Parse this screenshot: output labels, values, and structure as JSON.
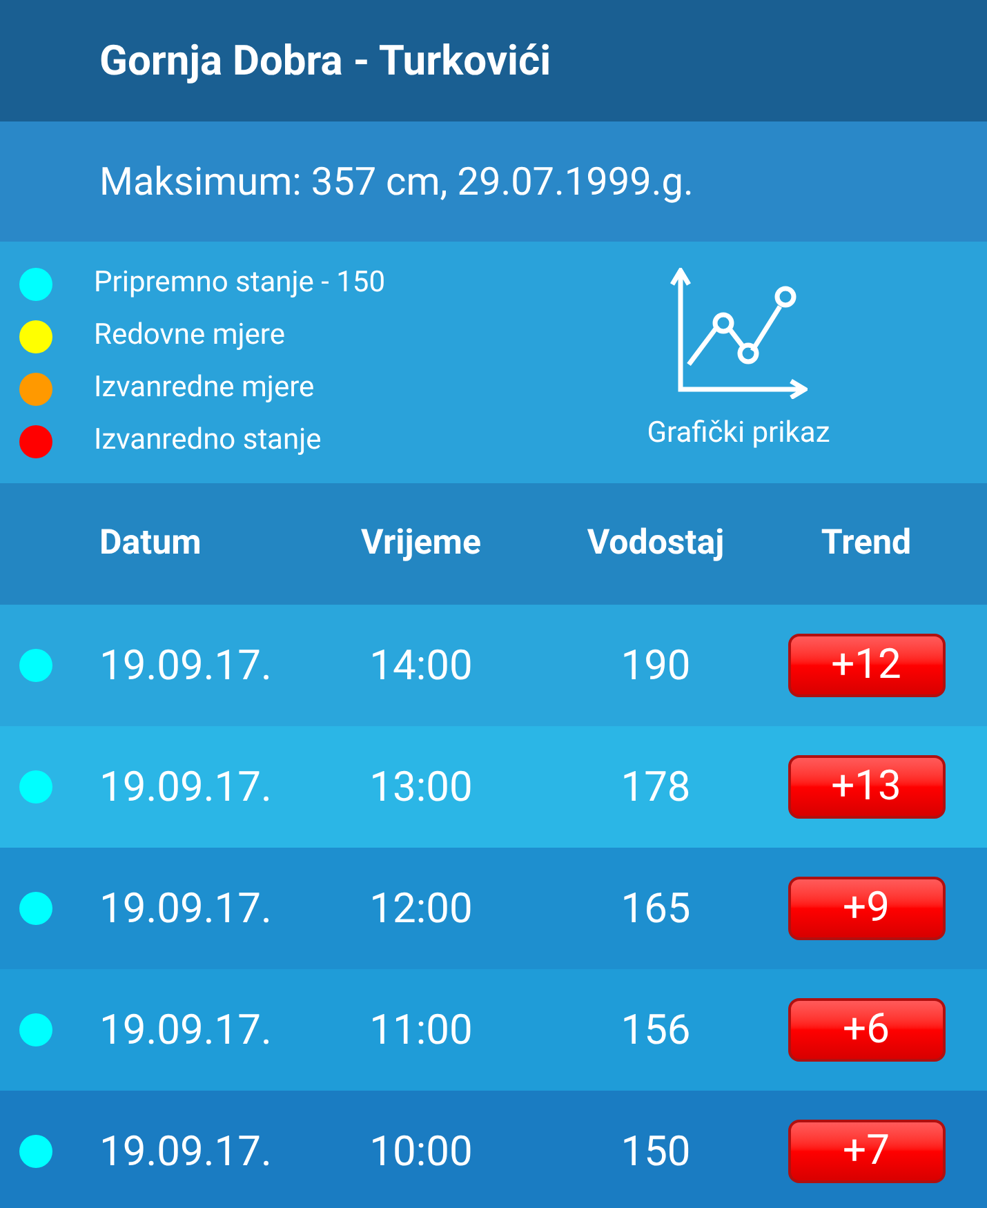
{
  "title": "Gornja Dobra - Turkovići",
  "maximum": "Maksimum: 357 cm, 29.07.1999.g.",
  "legend": [
    {
      "label": "Pripremno stanje - 150",
      "color": "#00ffff"
    },
    {
      "label": "Redovne mjere",
      "color": "#ffff00"
    },
    {
      "label": "Izvanredne mjere",
      "color": "#ff9900"
    },
    {
      "label": "Izvanredno stanje",
      "color": "#ff0000"
    }
  ],
  "chart_button": "Grafički prikaz",
  "columns": [
    "Datum",
    "Vrijeme",
    "Vodostaj",
    "Trend"
  ],
  "rows": [
    {
      "color": "#00ffff",
      "date": "19.09.17.",
      "time": "14:00",
      "level_cm": "190",
      "trend": "+12"
    },
    {
      "color": "#00ffff",
      "date": "19.09.17.",
      "time": "13:00",
      "level_cm": "178",
      "trend": "+13"
    },
    {
      "color": "#00ffff",
      "date": "19.09.17.",
      "time": "12:00",
      "level_cm": "165",
      "trend": "+9"
    },
    {
      "color": "#00ffff",
      "date": "19.09.17.",
      "time": "11:00",
      "level_cm": "156",
      "trend": "+6"
    },
    {
      "color": "#00ffff",
      "date": "19.09.17.",
      "time": "10:00",
      "level_cm": "150",
      "trend": "+7"
    }
  ]
}
